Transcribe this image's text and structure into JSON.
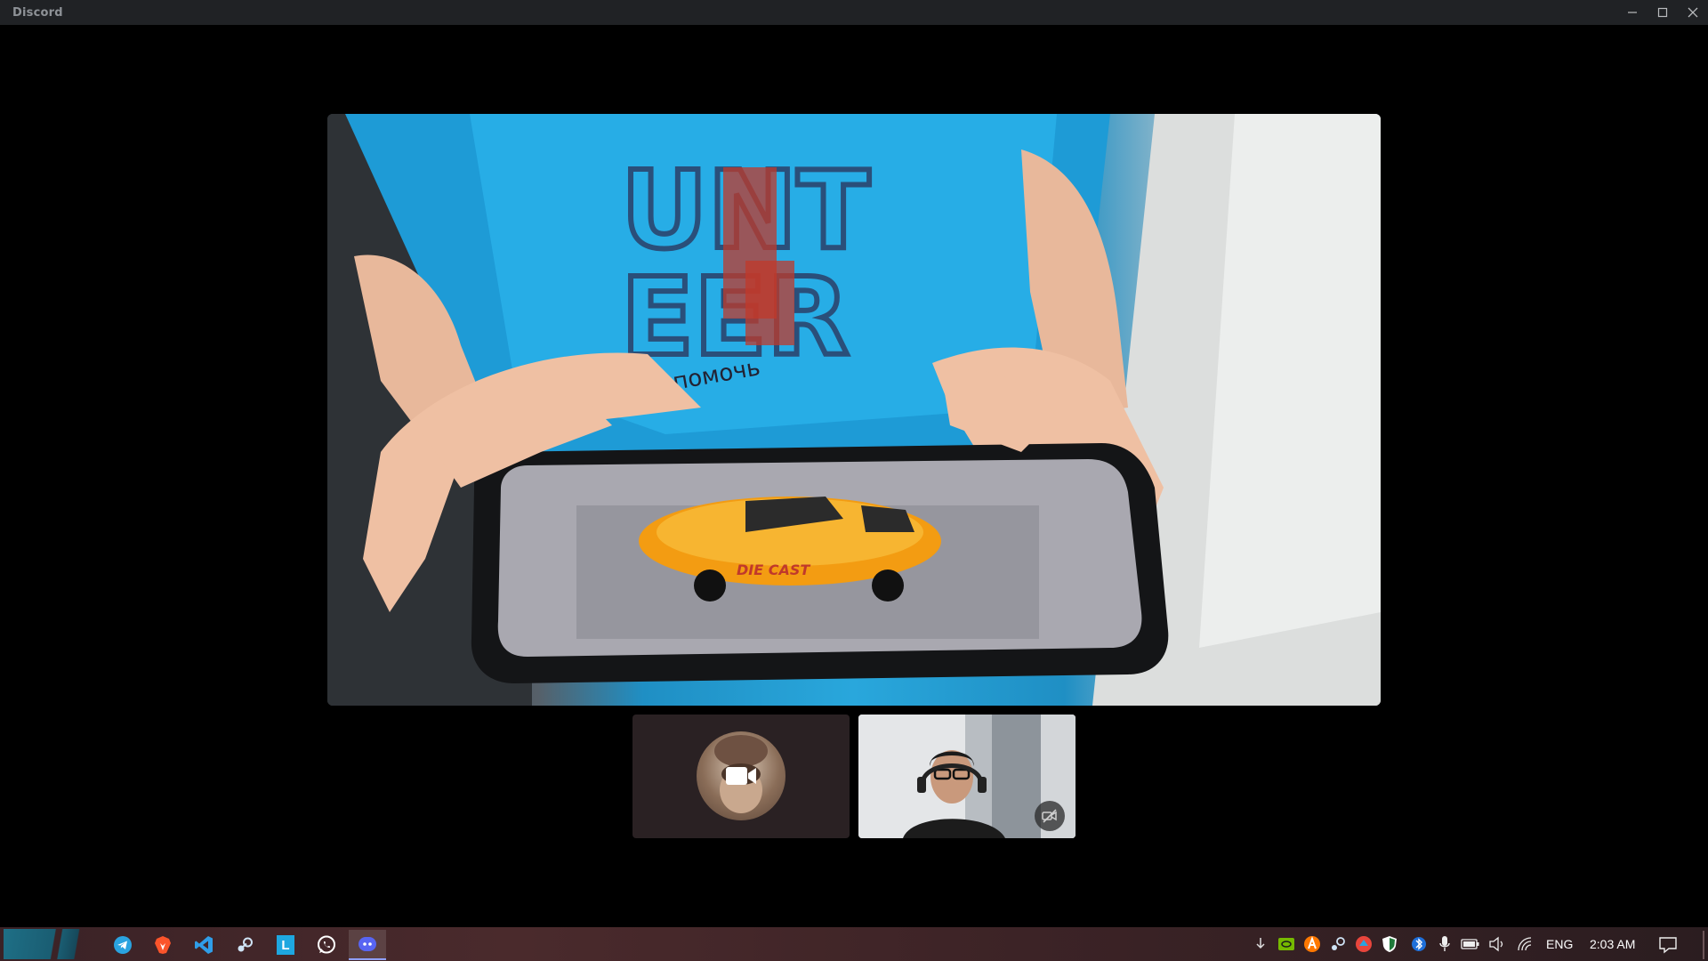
{
  "window": {
    "title": "Discord",
    "controls": {
      "minimize": "minimize-icon",
      "maximize": "maximize-icon",
      "close": "close-icon"
    }
  },
  "call": {
    "main_stream": {
      "description_icon": "screen-share-video",
      "shirt_text_lines": [
        "UNT",
        "EER",
        "помочь"
      ],
      "phone_app_car_text": "DIE CAST"
    },
    "participants": [
      {
        "type": "avatar",
        "camera_icon": "video-camera-icon"
      },
      {
        "type": "webcam",
        "overlay_icon": "video-off-icon"
      }
    ]
  },
  "taskbar": {
    "pinned_apps": [
      {
        "name": "telegram",
        "icon": "telegram-icon"
      },
      {
        "name": "brave",
        "icon": "brave-icon"
      },
      {
        "name": "vscode",
        "icon": "vscode-icon"
      },
      {
        "name": "steam",
        "icon": "steam-icon"
      },
      {
        "name": "launcher",
        "icon": "launcher-icon",
        "letter": "L"
      },
      {
        "name": "whatsapp",
        "icon": "whatsapp-icon"
      },
      {
        "name": "discord",
        "icon": "discord-icon",
        "active": true
      }
    ],
    "tray": {
      "language": "ENG",
      "time": "2:03 AM"
    }
  },
  "colors": {
    "titlebar": "#202225",
    "discord_blurple": "#5865f2",
    "tile_dark": "#2a2123"
  }
}
